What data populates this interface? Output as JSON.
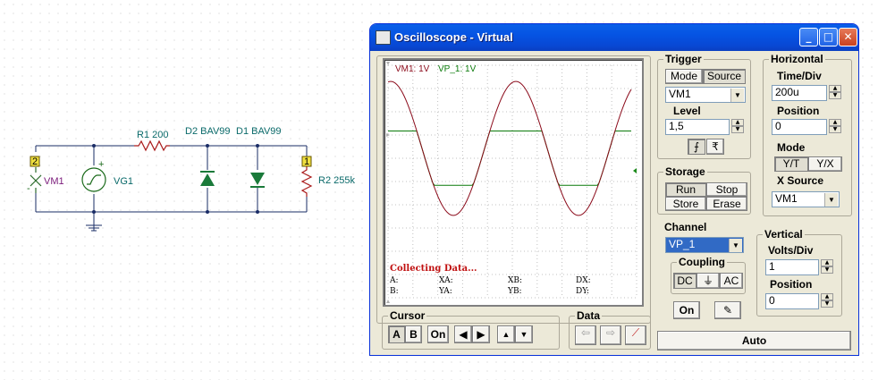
{
  "schematic": {
    "vm1_label": "VM1",
    "vm1_node": "2",
    "vg1_label": "VG1",
    "r1_label": "R1 200",
    "d2_label": "D2 BAV99",
    "d1_label": "D1 BAV99",
    "r2_label": "R2 255k",
    "r2_node": "1",
    "plus": "+",
    "minus": "-"
  },
  "window": {
    "title": "Oscilloscope - Virtual",
    "min_icon": "minimize-icon",
    "max_icon": "maximize-icon",
    "close_icon": "close-icon"
  },
  "screen": {
    "legend_vm1": "VM1: 1V",
    "legend_vp1": "VP_1: 1V",
    "status": "Collecting Data...",
    "readouts": [
      "A:",
      "XA:",
      "XB:",
      "DX:",
      "B:",
      "YA:",
      "YB:",
      "DY:"
    ],
    "colors": {
      "vm1": "#8b0a1a",
      "vp1": "#0a7a0a",
      "overlap": "#7070c0"
    }
  },
  "trigger": {
    "title": "Trigger",
    "mode_btn": "Mode",
    "source_btn": "Source",
    "source_value": "VM1",
    "level_label": "Level",
    "level_value": "1,5",
    "rising_icon": "rising-edge-icon",
    "falling_icon": "falling-edge-icon"
  },
  "horizontal": {
    "title": "Horizontal",
    "timediv_label": "Time/Div",
    "timediv_value": "200u",
    "position_label": "Position",
    "position_value": "0",
    "mode_label": "Mode",
    "yt_btn": "Y/T",
    "yx_btn": "Y/X",
    "xsource_label": "X Source",
    "xsource_value": "VM1"
  },
  "storage": {
    "title": "Storage",
    "run": "Run",
    "stop": "Stop",
    "store": "Store",
    "erase": "Erase"
  },
  "channel": {
    "title": "Channel",
    "value": "VP_1",
    "coupling_title": "Coupling",
    "dc": "DC",
    "gnd_icon": "ground-icon",
    "ac": "AC",
    "on_btn": "On",
    "probe_icon": "probe-icon"
  },
  "vertical": {
    "title": "Vertical",
    "voltsdiv_label": "Volts/Div",
    "voltsdiv_value": "1",
    "position_label": "Position",
    "position_value": "0"
  },
  "cursor": {
    "title": "Cursor",
    "a": "A",
    "b": "B",
    "on": "On"
  },
  "data": {
    "title": "Data"
  },
  "auto_btn": "Auto"
}
